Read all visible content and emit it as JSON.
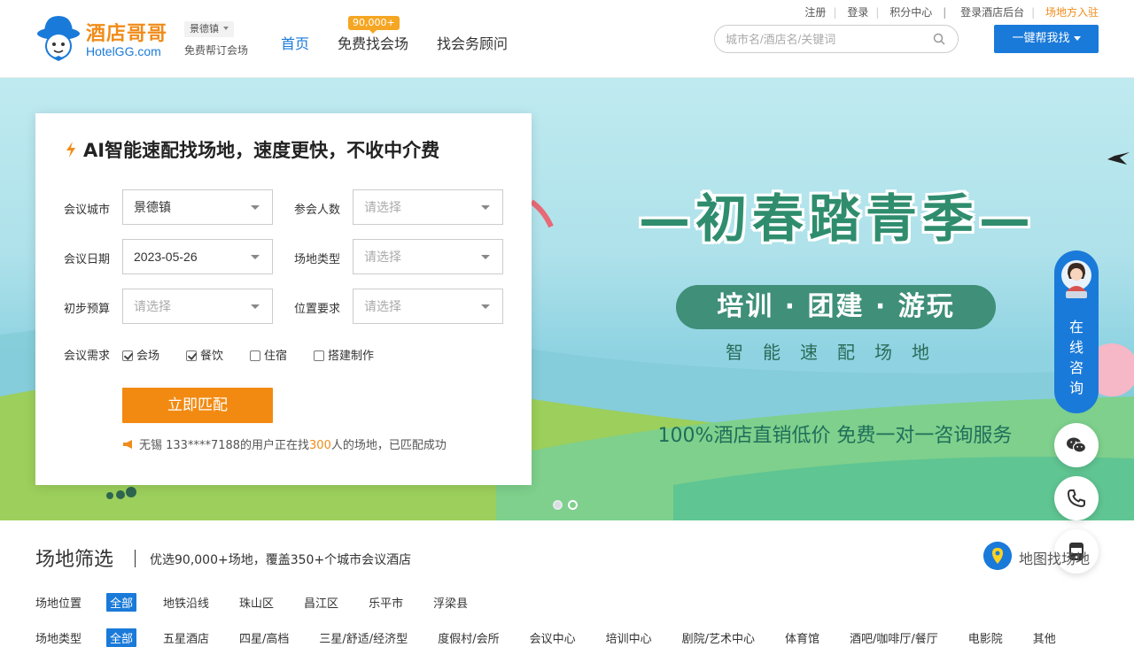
{
  "header": {
    "logo_cn": "酒店哥哥",
    "logo_en": "HotelGG.com",
    "city": "景德镇",
    "city_sub": "免费帮订会场",
    "nav": [
      {
        "label": "首页",
        "active": true
      },
      {
        "label": "免费找会场",
        "badge": "90,000+"
      },
      {
        "label": "找会务顾问"
      }
    ],
    "top_links": [
      "注册",
      "登录",
      "积分中心",
      "登录酒店后台",
      "场地方入驻"
    ],
    "search_placeholder": "城市名/酒店名/关键词",
    "help_button": "一键帮我找"
  },
  "banner": {
    "title": "—初春踏青季—",
    "pill": "培训 · 团建 · 游玩",
    "subtitle": "智能速配场地",
    "footer": "100%酒店直销低价   免费一对一咨询服务",
    "slides": 2,
    "active_slide": 1
  },
  "form": {
    "title": "AI智能速配找场地，速度更快，不收中介费",
    "fields": [
      {
        "label": "会议城市",
        "value": "景德镇",
        "placeholder": false
      },
      {
        "label": "参会人数",
        "value": "请选择",
        "placeholder": true
      },
      {
        "label": "会议日期",
        "value": "2023-05-26",
        "placeholder": false
      },
      {
        "label": "场地类型",
        "value": "请选择",
        "placeholder": true
      },
      {
        "label": "初步预算",
        "value": "请选择",
        "placeholder": true
      },
      {
        "label": "位置要求",
        "value": "请选择",
        "placeholder": true
      }
    ],
    "needs_label": "会议需求",
    "needs": [
      {
        "label": "会场",
        "checked": true
      },
      {
        "label": "餐饮",
        "checked": true
      },
      {
        "label": "住宿",
        "checked": false
      },
      {
        "label": "搭建制作",
        "checked": false
      }
    ],
    "submit": "立即匹配",
    "tip_prefix": "无锡 133****7188的用户正在找",
    "tip_count": "300",
    "tip_suffix": "人的场地，已匹配成功"
  },
  "side": {
    "consult": [
      "在",
      "线",
      "咨",
      "询"
    ]
  },
  "filters": {
    "title": "场地筛选",
    "subtitle": "优选90,000+场地，覆盖350+个城市会议酒店",
    "map_label": "地图找场地",
    "rows": [
      {
        "label": "场地位置",
        "options": [
          "全部",
          "地铁沿线",
          "珠山区",
          "昌江区",
          "乐平市",
          "浮梁县"
        ]
      },
      {
        "label": "场地类型",
        "options": [
          "全部",
          "五星酒店",
          "四星/高档",
          "三星/舒适/经济型",
          "度假村/会所",
          "会议中心",
          "培训中心",
          "剧院/艺术中心",
          "体育馆",
          "酒吧/咖啡厅/餐厅",
          "电影院",
          "其他"
        ]
      }
    ]
  },
  "colors": {
    "brand_blue": "#1a7ad9",
    "brand_orange": "#f28a12",
    "banner_green": "#3f8f79"
  }
}
